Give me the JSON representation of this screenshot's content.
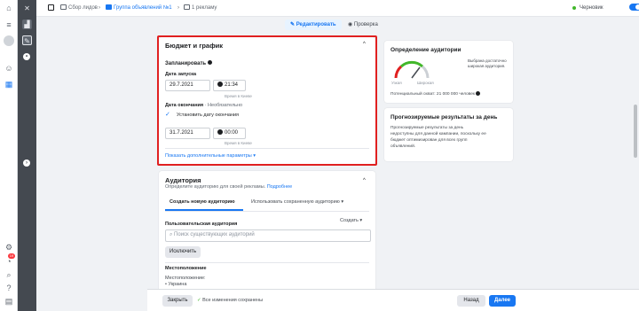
{
  "breadcrumb": {
    "campaign": "Сбор лидов",
    "adset": "Группа объявлений №1",
    "ad": "1 рекламу"
  },
  "status": {
    "label": "Черновик"
  },
  "modes": {
    "edit": "Редактировать",
    "review": "Проверка"
  },
  "budget": {
    "title": "Бюджет и график",
    "scheduled_label": "Запланировать",
    "start_label": "Дата запуска",
    "start_date": "29.7.2021",
    "start_time": "21:34",
    "tz_note_1": "Время в Киеве",
    "end_label": "Дата окончания",
    "end_optional": "· Необязательно",
    "set_end_label": "Установить дату окончания",
    "end_date": "31.7.2021",
    "end_time": "00:00",
    "tz_note_2": "Время в Киеве",
    "more_link": "Показать дополнительные параметры ▾"
  },
  "audience": {
    "title": "Аудитория",
    "subtitle": "Определите аудиторию для своей рекламы.",
    "subtitle_link": "Подробнее",
    "tab_new": "Создать новую аудиторию",
    "tab_saved": "Использовать сохраненную аудиторию ▾",
    "custom_label": "Пользовательская аудитория",
    "create_label": "Создать",
    "search_placeholder": "Поиск существующих аудиторий",
    "exclude_button": "Исключить",
    "location_title": "Местоположение",
    "location_label": "Местоположение:",
    "location_value": "• Украина"
  },
  "definition": {
    "title": "Определение аудитории",
    "gauge_desc": "Выбрана достаточно широкая аудитория.",
    "narrow": "Узкая",
    "broad": "Широкая",
    "reach": "Потенциальный охват: 21 000 000 человек"
  },
  "forecast": {
    "title": "Прогнозируемые результаты за день",
    "text_1": "Прогнозируемые результаты за день",
    "text_2": "недоступны для данной кампании, поскольку ее",
    "text_3": "бюджет оптимизирован для всех групп",
    "text_4": "объявлений."
  },
  "footer": {
    "close": "Закрыть",
    "saved": "Все изменения сохранены",
    "back": "Назад",
    "next": "Далее"
  },
  "badge": {
    "count": "19"
  },
  "colors": {
    "accent": "#1877f2",
    "highlight": "#e02020",
    "success": "#42b72a"
  }
}
